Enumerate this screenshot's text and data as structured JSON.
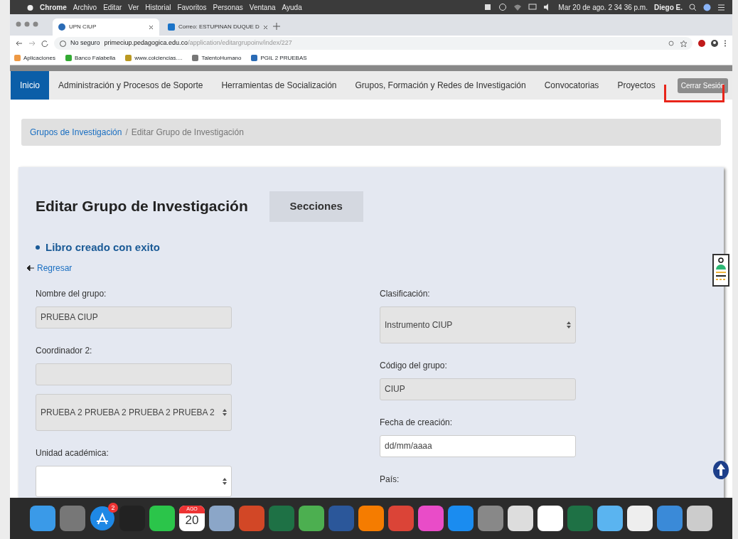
{
  "menubar": {
    "app": "Chrome",
    "menus": [
      "Archivo",
      "Editar",
      "Ver",
      "Historial",
      "Favoritos",
      "Personas",
      "Ventana",
      "Ayuda"
    ],
    "clock": "Mar 20 de ago.  2 34 36 p.m.",
    "user": "Diego E."
  },
  "browser": {
    "tabs": [
      {
        "title": "UPN CIUP",
        "selected": true
      },
      {
        "title": "Correo: ESTUPINAN DUQUE D",
        "selected": false
      }
    ],
    "address": {
      "security": "No seguro",
      "host": "primeciup.pedagogica.edu.co",
      "path": "/application/editargrupoinv/index/227"
    },
    "bookmarks": [
      "Aplicaciones",
      "Banco Falabella",
      "www.colciencias....",
      "TalentoHumano",
      "PGIL 2 PRUEBAS"
    ]
  },
  "nav": {
    "items": [
      {
        "label": "Inicio",
        "selected": true
      },
      {
        "label": "Administración y Procesos de Soporte",
        "selected": false
      },
      {
        "label": "Herramientas de Socialización",
        "selected": false
      },
      {
        "label": "Grupos, Formación y Redes de Investigación",
        "selected": false
      },
      {
        "label": "Convocatorias",
        "selected": false
      },
      {
        "label": "Proyectos",
        "selected": false
      }
    ],
    "logout": "Cerrar Sesión"
  },
  "breadcrumb": [
    "Grupos de Investigación",
    "Editar Grupo de Investigación"
  ],
  "breadcrumb_separator": "/",
  "page": {
    "title": "Editar Grupo de Investigación",
    "sections_button": "Secciones",
    "alert": "Libro creado con exito",
    "back_link": "Regresar"
  },
  "form_left": [
    {
      "label": "Nombre del grupo:",
      "kind": "text",
      "value": "PRUEBA CIUP",
      "readonly": true
    },
    {
      "label": "Coordinador 2:",
      "kind": "text",
      "readonly": true
    },
    {
      "kind": "select",
      "value": "PRUEBA 2 PRUEBA 2 PRUEBA 2 PRUEBA 2",
      "readonly": true
    },
    {
      "label": "Unidad académica:",
      "kind": "select",
      "readonly": false
    }
  ],
  "form_right": [
    {
      "label": "Clasificación:",
      "kind": "select",
      "value": "Instrumento CIUP",
      "readonly": true
    },
    {
      "label": "Código del grupo:",
      "kind": "text",
      "value": "CIUP",
      "readonly": true
    },
    {
      "label": "Fecha de creación:",
      "kind": "text",
      "value": "dd/mm/aaaa",
      "readonly": false
    },
    {
      "label": "País:",
      "kind": "label"
    }
  ],
  "dock": {
    "appstore_badge": "2",
    "calendar_month": "AGO",
    "calendar_day": "20"
  }
}
